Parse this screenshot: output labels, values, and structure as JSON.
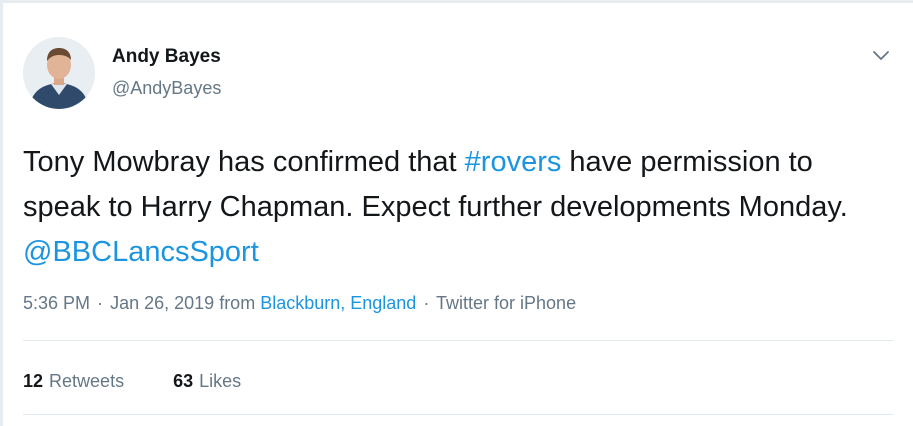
{
  "author": {
    "display_name": "Andy Bayes",
    "handle": "@AndyBayes"
  },
  "tweet": {
    "text_parts": [
      {
        "text": "Tony Mowbray has confirmed that ",
        "type": "text"
      },
      {
        "text": "#rovers",
        "type": "hashtag"
      },
      {
        "text": " have permission to speak to Harry Chapman. Expect further developments Monday. ",
        "type": "text"
      },
      {
        "text": "@BBCLancsSport",
        "type": "mention"
      }
    ]
  },
  "meta": {
    "time": "5:36 PM",
    "separator": "·",
    "date": "Jan 26, 2019",
    "from_label": "from",
    "location": "Blackburn, England",
    "source": "Twitter for iPhone"
  },
  "stats": {
    "retweets_count": "12",
    "retweets_label": "Retweets",
    "likes_count": "63",
    "likes_label": "Likes"
  },
  "icons": {
    "menu": "chevron-down-icon",
    "avatar": "profile-photo"
  },
  "colors": {
    "link": "#1b95e0",
    "text": "#14171a",
    "secondary": "#657786",
    "divider": "#e1e8ed",
    "page_bg": "#e6ecf0"
  }
}
